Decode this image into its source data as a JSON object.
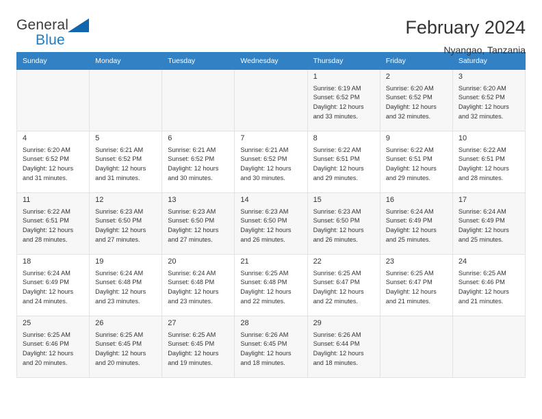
{
  "brand": {
    "name_top": "General",
    "name_bottom": "Blue",
    "accent_color": "#1f7bc1",
    "triangle_color": "#1166ae"
  },
  "header": {
    "title": "February 2024",
    "location": "Nyangao, Tanzania"
  },
  "theme": {
    "header_row_bg": "#3281c4",
    "header_row_text": "#ffffff",
    "shaded_row_bg": "#f7f7f7",
    "grid_line": "#e2e2e2"
  },
  "weekdays": [
    "Sunday",
    "Monday",
    "Tuesday",
    "Wednesday",
    "Thursday",
    "Friday",
    "Saturday"
  ],
  "weeks": [
    [
      {
        "day": "",
        "info": ""
      },
      {
        "day": "",
        "info": ""
      },
      {
        "day": "",
        "info": ""
      },
      {
        "day": "",
        "info": ""
      },
      {
        "day": "1",
        "info": "Sunrise: 6:19 AM\nSunset: 6:52 PM\nDaylight: 12 hours\nand 33 minutes."
      },
      {
        "day": "2",
        "info": "Sunrise: 6:20 AM\nSunset: 6:52 PM\nDaylight: 12 hours\nand 32 minutes."
      },
      {
        "day": "3",
        "info": "Sunrise: 6:20 AM\nSunset: 6:52 PM\nDaylight: 12 hours\nand 32 minutes."
      }
    ],
    [
      {
        "day": "4",
        "info": "Sunrise: 6:20 AM\nSunset: 6:52 PM\nDaylight: 12 hours\nand 31 minutes."
      },
      {
        "day": "5",
        "info": "Sunrise: 6:21 AM\nSunset: 6:52 PM\nDaylight: 12 hours\nand 31 minutes."
      },
      {
        "day": "6",
        "info": "Sunrise: 6:21 AM\nSunset: 6:52 PM\nDaylight: 12 hours\nand 30 minutes."
      },
      {
        "day": "7",
        "info": "Sunrise: 6:21 AM\nSunset: 6:52 PM\nDaylight: 12 hours\nand 30 minutes."
      },
      {
        "day": "8",
        "info": "Sunrise: 6:22 AM\nSunset: 6:51 PM\nDaylight: 12 hours\nand 29 minutes."
      },
      {
        "day": "9",
        "info": "Sunrise: 6:22 AM\nSunset: 6:51 PM\nDaylight: 12 hours\nand 29 minutes."
      },
      {
        "day": "10",
        "info": "Sunrise: 6:22 AM\nSunset: 6:51 PM\nDaylight: 12 hours\nand 28 minutes."
      }
    ],
    [
      {
        "day": "11",
        "info": "Sunrise: 6:22 AM\nSunset: 6:51 PM\nDaylight: 12 hours\nand 28 minutes."
      },
      {
        "day": "12",
        "info": "Sunrise: 6:23 AM\nSunset: 6:50 PM\nDaylight: 12 hours\nand 27 minutes."
      },
      {
        "day": "13",
        "info": "Sunrise: 6:23 AM\nSunset: 6:50 PM\nDaylight: 12 hours\nand 27 minutes."
      },
      {
        "day": "14",
        "info": "Sunrise: 6:23 AM\nSunset: 6:50 PM\nDaylight: 12 hours\nand 26 minutes."
      },
      {
        "day": "15",
        "info": "Sunrise: 6:23 AM\nSunset: 6:50 PM\nDaylight: 12 hours\nand 26 minutes."
      },
      {
        "day": "16",
        "info": "Sunrise: 6:24 AM\nSunset: 6:49 PM\nDaylight: 12 hours\nand 25 minutes."
      },
      {
        "day": "17",
        "info": "Sunrise: 6:24 AM\nSunset: 6:49 PM\nDaylight: 12 hours\nand 25 minutes."
      }
    ],
    [
      {
        "day": "18",
        "info": "Sunrise: 6:24 AM\nSunset: 6:49 PM\nDaylight: 12 hours\nand 24 minutes."
      },
      {
        "day": "19",
        "info": "Sunrise: 6:24 AM\nSunset: 6:48 PM\nDaylight: 12 hours\nand 23 minutes."
      },
      {
        "day": "20",
        "info": "Sunrise: 6:24 AM\nSunset: 6:48 PM\nDaylight: 12 hours\nand 23 minutes."
      },
      {
        "day": "21",
        "info": "Sunrise: 6:25 AM\nSunset: 6:48 PM\nDaylight: 12 hours\nand 22 minutes."
      },
      {
        "day": "22",
        "info": "Sunrise: 6:25 AM\nSunset: 6:47 PM\nDaylight: 12 hours\nand 22 minutes."
      },
      {
        "day": "23",
        "info": "Sunrise: 6:25 AM\nSunset: 6:47 PM\nDaylight: 12 hours\nand 21 minutes."
      },
      {
        "day": "24",
        "info": "Sunrise: 6:25 AM\nSunset: 6:46 PM\nDaylight: 12 hours\nand 21 minutes."
      }
    ],
    [
      {
        "day": "25",
        "info": "Sunrise: 6:25 AM\nSunset: 6:46 PM\nDaylight: 12 hours\nand 20 minutes."
      },
      {
        "day": "26",
        "info": "Sunrise: 6:25 AM\nSunset: 6:45 PM\nDaylight: 12 hours\nand 20 minutes."
      },
      {
        "day": "27",
        "info": "Sunrise: 6:25 AM\nSunset: 6:45 PM\nDaylight: 12 hours\nand 19 minutes."
      },
      {
        "day": "28",
        "info": "Sunrise: 6:26 AM\nSunset: 6:45 PM\nDaylight: 12 hours\nand 18 minutes."
      },
      {
        "day": "29",
        "info": "Sunrise: 6:26 AM\nSunset: 6:44 PM\nDaylight: 12 hours\nand 18 minutes."
      },
      {
        "day": "",
        "info": ""
      },
      {
        "day": "",
        "info": ""
      }
    ]
  ]
}
